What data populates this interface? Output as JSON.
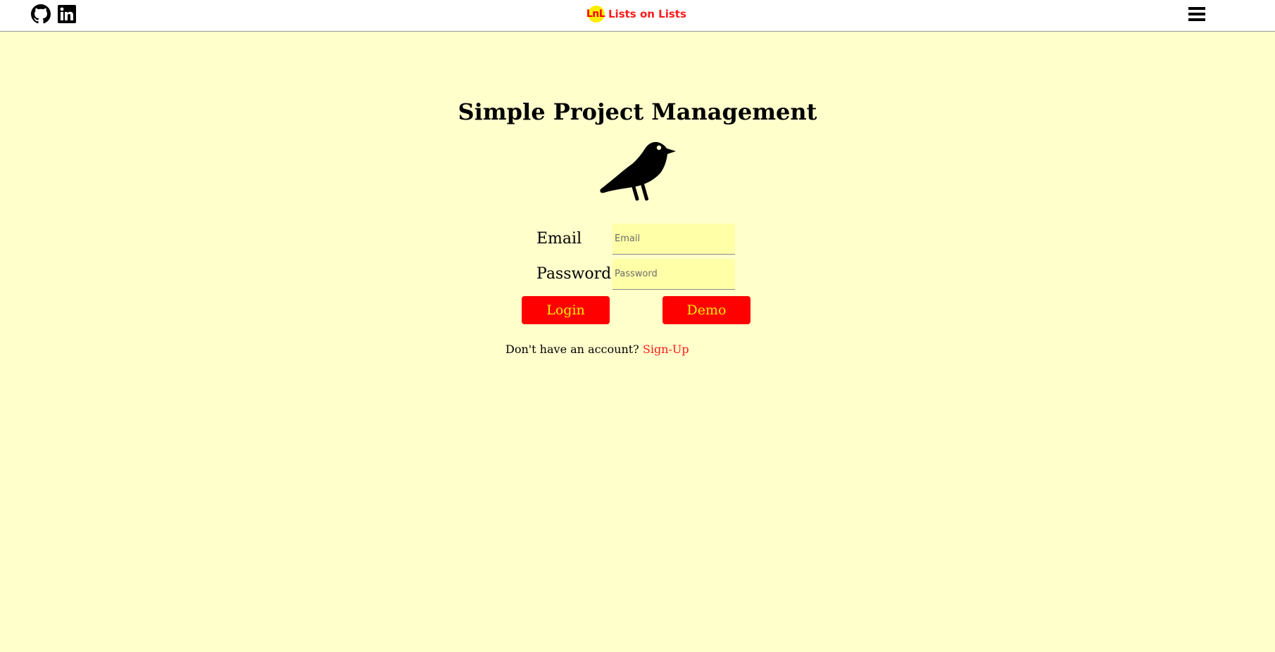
{
  "navbar": {
    "github_icon": "github-icon",
    "linkedin_icon": "linkedin-icon",
    "brand_logo_text": "LnL",
    "brand_name": "Lists on Lists",
    "menu_icon": "hamburger-menu-icon"
  },
  "main": {
    "title": "Simple Project Management",
    "logo_icon": "crow-icon",
    "email_label": "Email",
    "email_placeholder": "Email",
    "email_value": "",
    "password_label": "Password",
    "password_placeholder": "Password",
    "password_value": "",
    "login_label": "Login",
    "demo_label": "Demo",
    "signup_prompt": "Don't have an account?",
    "signup_link": "Sign-Up"
  },
  "colors": {
    "background": "#ffffcc",
    "input_background": "#ffffa8",
    "button_background": "#ff0000",
    "button_text": "#ffee00",
    "accent": "#ff1a1a"
  }
}
